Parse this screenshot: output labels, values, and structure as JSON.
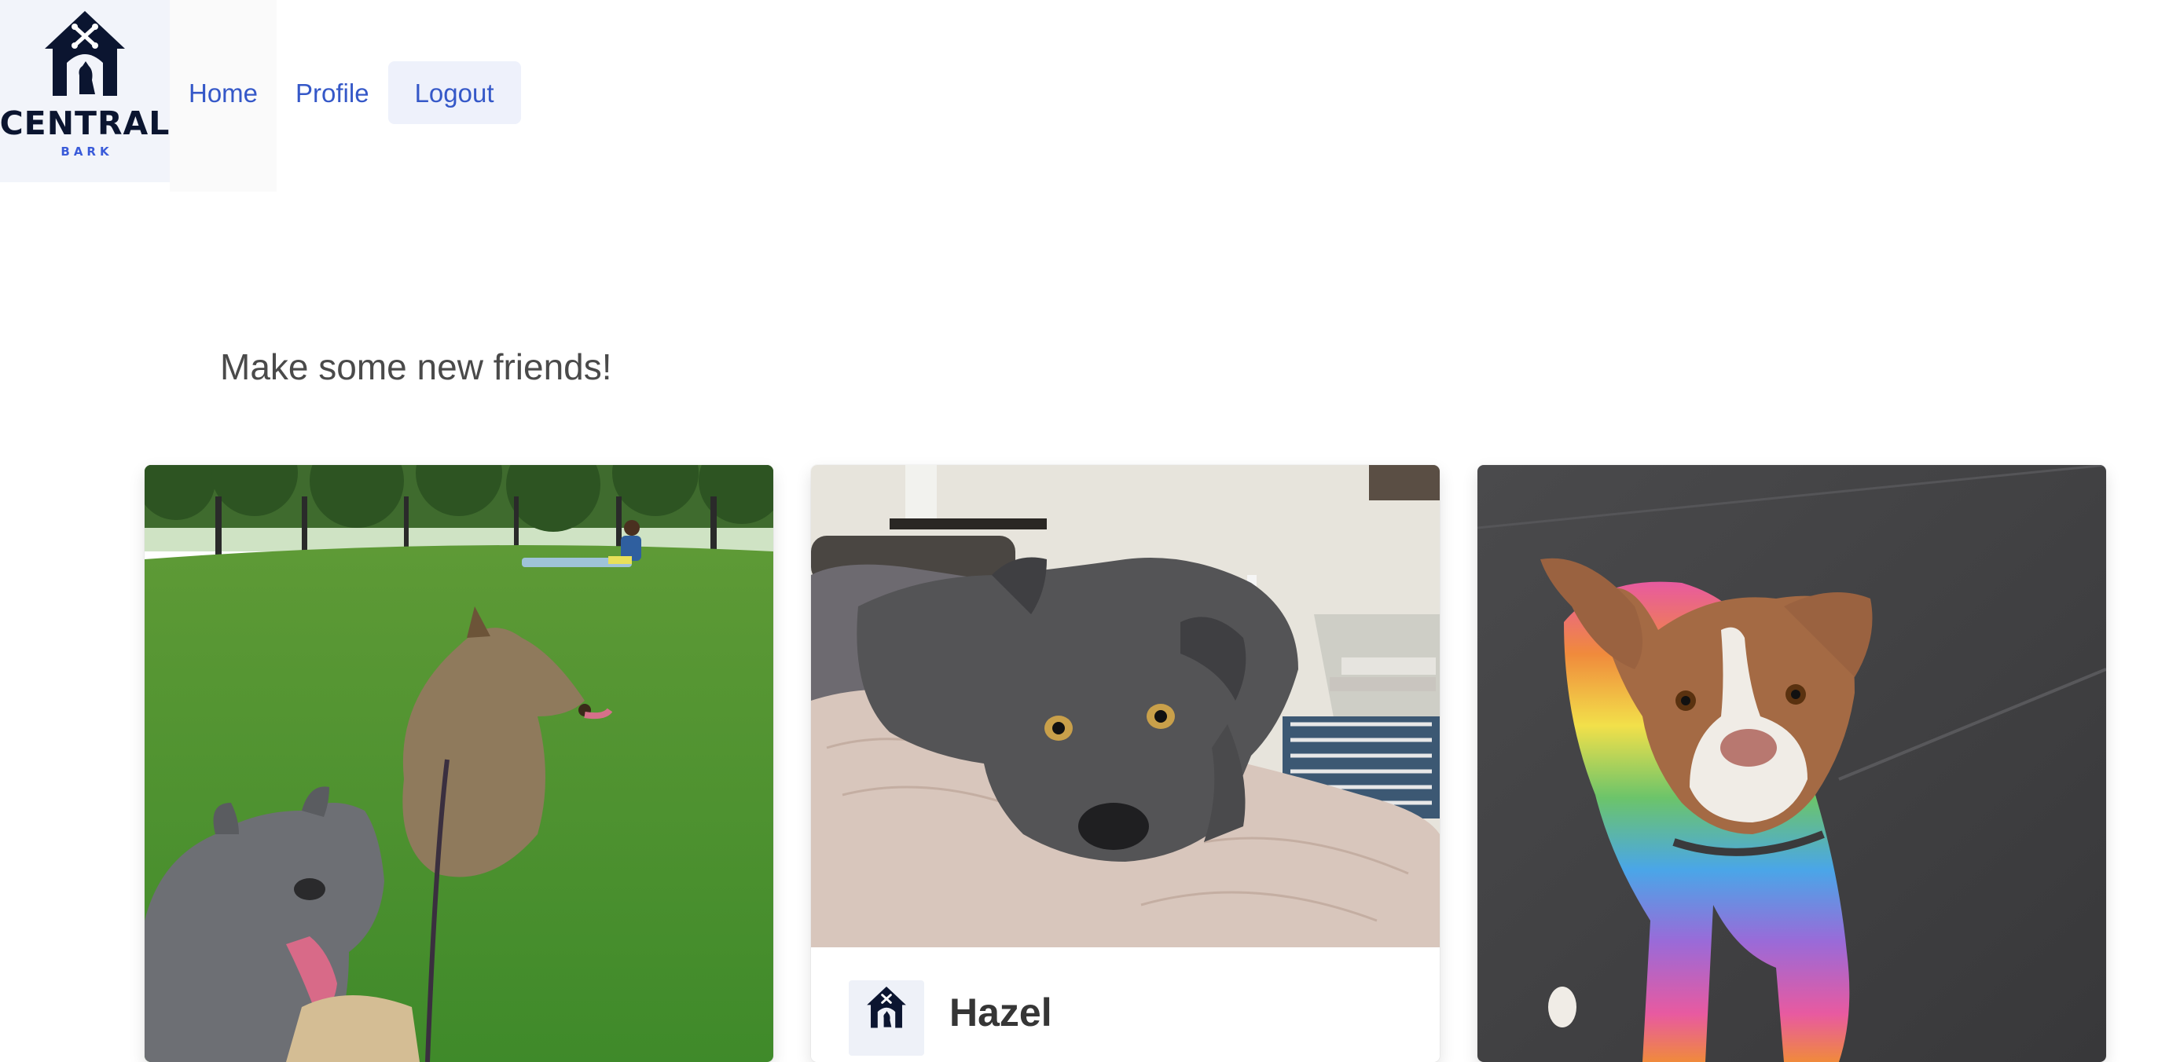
{
  "brand": {
    "name": "CENTRAL",
    "subtitle": "BARK",
    "colors": {
      "primary": "#0b1530",
      "accent": "#3a5bd9"
    }
  },
  "nav": {
    "home_label": "Home",
    "profile_label": "Profile",
    "logout_label": "Logout",
    "link_color": "#3558c8"
  },
  "main": {
    "heading": "Make some new friends!"
  },
  "cards": [
    {
      "title": "",
      "image": "dogs-in-park-photo"
    },
    {
      "title": "Hazel",
      "image": "gray-dog-on-blanket-photo"
    },
    {
      "title": "",
      "image": "dog-in-rainbow-sweater-photo"
    }
  ],
  "icons": {
    "logo": "dog-house-logo-icon",
    "avatar": "dog-house-avatar-icon"
  }
}
